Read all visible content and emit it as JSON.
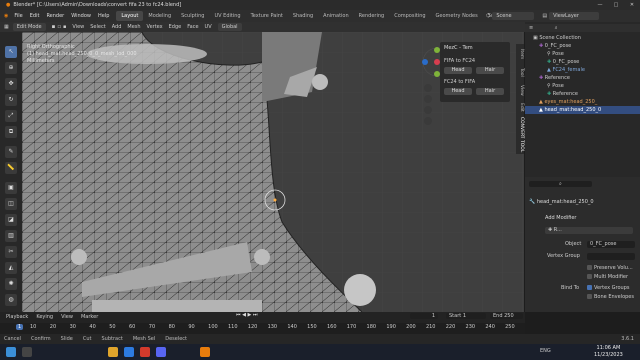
{
  "window": {
    "title": "Blender* [C:\\Users\\Admin\\Downloads\\convert fifa 23 to fc24.blend]",
    "controls": [
      "—",
      "□",
      "✕"
    ]
  },
  "menu": [
    "File",
    "Edit",
    "Render",
    "Window",
    "Help"
  ],
  "workspaces": [
    "Layout",
    "Modeling",
    "Sculpting",
    "UV Editing",
    "Texture Paint",
    "Shading",
    "Animation",
    "Rendering",
    "Compositing",
    "Geometry Nodes",
    "Scripting"
  ],
  "scene": {
    "name": "Scene",
    "view_layer": "ViewLayer"
  },
  "header": {
    "mode": "Edit Mode",
    "items": [
      "View",
      "Select",
      "Add",
      "Mesh",
      "Vertex",
      "Edge",
      "Face",
      "UV"
    ],
    "orientation": "Global"
  },
  "viewport": {
    "line1": "Right Orthographic",
    "line2": "(1) head_mat:head_250_0_0_mesh_lod_000",
    "line3": "Millimeters"
  },
  "npanel": {
    "title": "MezC - Tem",
    "section1": "FIFA to FC24",
    "section2": "FC24 to FIFA",
    "btn_head": "Head",
    "btn_hair": "Hair"
  },
  "side_tabs": [
    "Item",
    "Tool",
    "View",
    "Edit",
    "CONVERT TOOL"
  ],
  "outliner": {
    "rows": [
      {
        "label": "Scene Collection",
        "indent": 1
      },
      {
        "label": "0_FC_pose",
        "indent": 2
      },
      {
        "label": "Pose",
        "indent": 3
      },
      {
        "label": "0_FC_pose",
        "indent": 3
      },
      {
        "label": "FC24_female",
        "indent": 3
      },
      {
        "label": "Reference",
        "indent": 2
      },
      {
        "label": "Pose",
        "indent": 3
      },
      {
        "label": "Reference",
        "indent": 3
      },
      {
        "label": "eyes_mat:head_250_",
        "indent": 2
      },
      {
        "label": "head_mat:head_250_0",
        "indent": 2
      }
    ],
    "selected_index": 9
  },
  "properties": {
    "object_name": "head_mat:head_250_0",
    "add_modifier": "Add Modifier",
    "modifier_name": "R...",
    "object_label": "Object",
    "object_value": "0_FC_pose",
    "vgroup_label": "Vertex Group",
    "preserve": "Preserve Volu...",
    "multi": "Multi Modifier",
    "bind_label": "Bind To",
    "vgroups": "Vertex Groups",
    "bone_env": "Bone Envelopes"
  },
  "timeline": {
    "menu": [
      "Playback",
      "Keying",
      "View",
      "Marker"
    ],
    "current_frame": "1",
    "start_label": "Start",
    "start": "1",
    "end_label": "End",
    "end": "250",
    "ticks": [
      "10",
      "20",
      "30",
      "40",
      "50",
      "60",
      "70",
      "80",
      "90",
      "100",
      "110",
      "120",
      "130",
      "140",
      "150",
      "160",
      "170",
      "180",
      "190",
      "200",
      "210",
      "220",
      "230",
      "240",
      "250"
    ]
  },
  "statusbar": {
    "items": [
      "Cancel",
      "Confirm",
      "Slide",
      "Cut",
      "Subtract",
      "Mesh Sel",
      "Deselect"
    ],
    "version": "3.6.1"
  },
  "taskbar": {
    "time": "11:06 AM",
    "date": "11/23/2023",
    "lang": "ENG"
  },
  "colors": {
    "accent": "#4772b3",
    "viewport": "#3f3f3f",
    "wire": "#1b1b1b"
  }
}
